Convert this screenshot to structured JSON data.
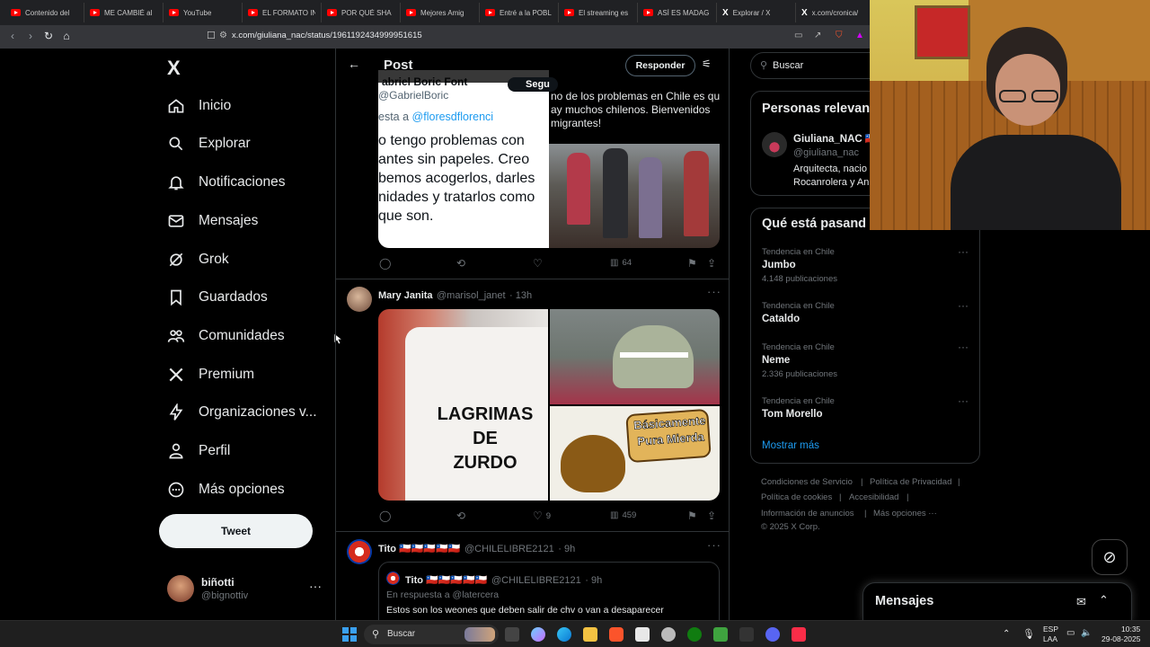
{
  "browser": {
    "tabs": [
      {
        "label": "Contenido del",
        "icon": "youtube-icon"
      },
      {
        "label": "ME CAMBIÉ al",
        "icon": "youtube-icon"
      },
      {
        "label": "YouTube",
        "icon": "youtube-icon"
      },
      {
        "label": "EL FORMATO IN",
        "icon": "youtube-icon"
      },
      {
        "label": "POR QUÉ SHA",
        "icon": "youtube-icon"
      },
      {
        "label": "Mejores Amig",
        "icon": "youtube-icon"
      },
      {
        "label": "Entré a la POBL",
        "icon": "youtube-icon"
      },
      {
        "label": "El streaming es",
        "icon": "youtube-icon"
      },
      {
        "label": "ASÍ ES MADAG",
        "icon": "youtube-icon"
      },
      {
        "label": "Explorar / X",
        "icon": "x-icon"
      },
      {
        "label": "x.com/cronica/",
        "icon": "x-icon"
      }
    ],
    "url": "x.com/giuliana_nac/status/1961192434999951615"
  },
  "nav": {
    "logo": "X",
    "items": [
      {
        "label": "Inicio",
        "icon": "home-icon"
      },
      {
        "label": "Explorar",
        "icon": "search-icon"
      },
      {
        "label": "Notificaciones",
        "icon": "bell-icon"
      },
      {
        "label": "Mensajes",
        "icon": "mail-icon"
      },
      {
        "label": "Grok",
        "icon": "grok-icon"
      },
      {
        "label": "Guardados",
        "icon": "bookmark-icon"
      },
      {
        "label": "Comunidades",
        "icon": "communities-icon"
      },
      {
        "label": "Premium",
        "icon": "x-premium-icon"
      },
      {
        "label": "Organizaciones v...",
        "icon": "lightning-icon"
      },
      {
        "label": "Perfil",
        "icon": "person-icon"
      },
      {
        "label": "Más opciones",
        "icon": "more-circle-icon"
      }
    ],
    "tweet_label": "Tweet",
    "profile": {
      "name": "biñotti",
      "handle": "@bignottiv",
      "more": "···"
    }
  },
  "header": {
    "title": "Post",
    "reply_label": "Responder"
  },
  "posts": [
    {
      "quote_author": "abriel Boric Font",
      "quote_handle": "@GabrielBoric",
      "follow_label": "Segu",
      "reply_prefix": "esta a",
      "reply_target": "@floresdflorenci",
      "quote_text_lines": [
        "o tengo problemas con",
        "antes sin papeles. Creo",
        "bemos acogerlos, darles",
        "nidades y tratarlos como",
        " que son."
      ],
      "side_text_lines": [
        "no de los problemas en Chile es qu",
        "ay muchos chilenos. Bienvenidos",
        "migrantes!"
      ],
      "views": "64"
    },
    {
      "name": "Mary Janita",
      "handle": "@marisol_janet",
      "time": "· 13h",
      "mug_text_lines": [
        "LAGRIMAS",
        "DE",
        "ZURDO"
      ],
      "sign_text_lines": [
        "Básicamente",
        "Pura Mierda"
      ],
      "likes": "9",
      "views": "459"
    },
    {
      "name": "Tito 🇨🇱🇨🇱🇨🇱🇨🇱🇨🇱",
      "handle": "@CHILELIBRE2121",
      "time": "· 9h",
      "quote_name": "Tito 🇨🇱🇨🇱🇨🇱🇨🇱🇨🇱",
      "quote_handle": "@CHILELIBRE2121",
      "quote_time": "· 9h",
      "quote_reply_to": "En respuesta a @latercera",
      "quote_text": "Estos son los weones que deben salir de chv o van a desaparecer"
    }
  ],
  "right": {
    "search_placeholder": "Buscar",
    "relevant_title": "Personas relevan",
    "relevant_person": {
      "name": "Giuliana_NAC 🇨🇱",
      "handle": "@giuliana_nac",
      "bio_lines": [
        "Arquitecta, nacio",
        "Rocanrolera y An"
      ]
    },
    "trends_title": "Qué está pasand",
    "trends": [
      {
        "context": "Tendencia en Chile",
        "name": "Jumbo",
        "count": "4.148 publicaciones"
      },
      {
        "context": "Tendencia en Chile",
        "name": "Cataldo",
        "count": ""
      },
      {
        "context": "Tendencia en Chile",
        "name": "Neme",
        "count": "2.336 publicaciones"
      },
      {
        "context": "Tendencia en Chile",
        "name": "Tom Morello",
        "count": ""
      }
    ],
    "show_more": "Mostrar más",
    "footer": [
      "Condiciones de Servicio",
      "|",
      "Política de Privacidad",
      "|",
      "Política de cookies",
      "|",
      "Accesibilidad",
      "|",
      "Información de anuncios",
      "|",
      "Más opciones ···",
      "© 2025 X Corp."
    ]
  },
  "messages_drawer": {
    "title": "Mensajes"
  },
  "taskbar": {
    "search_label": "Buscar",
    "lang": "ESP",
    "lang2": "LAA",
    "time": "10:35",
    "date": "29-08-2025"
  }
}
